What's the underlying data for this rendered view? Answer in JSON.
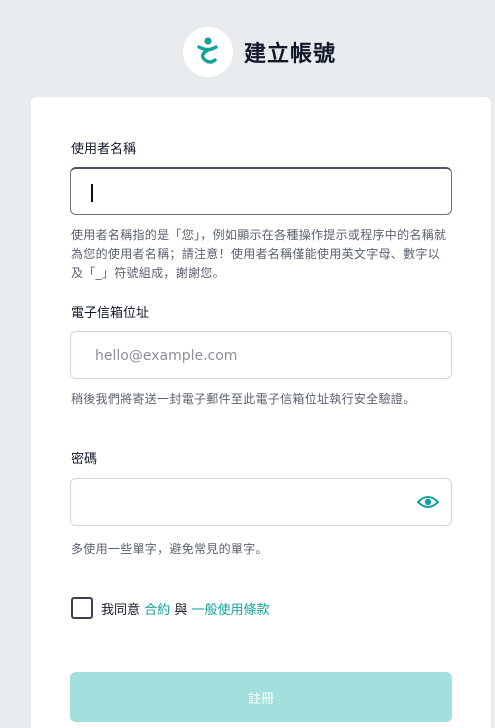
{
  "header": {
    "title": "建立帳號",
    "logo_icon": "brand-logo-icon",
    "brand_color": "#14a39a"
  },
  "form": {
    "username": {
      "label": "使用者名稱",
      "value": "",
      "help": "使用者名稱指的是「您」，例如顯示在各種操作提示或程序中的名稱就為您的使用者名稱；請注意！使用者名稱僅能使用英文字母、數字以及「_」符號組成，謝謝您。"
    },
    "email": {
      "label": "電子信箱位址",
      "placeholder": "hello@example.com",
      "help": "稍後我們將寄送一封電子郵件至此電子信箱位址執行安全驗證。"
    },
    "password": {
      "label": "密碼",
      "value": "",
      "toggle_icon": "eye-icon",
      "help": "多使用一些單字，避免常見的單字。"
    },
    "agreement": {
      "checked": false,
      "prefix": "我同意",
      "terms_link": "合約",
      "conjunction": "與",
      "policy_link": "一般使用條款"
    },
    "submit_label": "註冊"
  }
}
